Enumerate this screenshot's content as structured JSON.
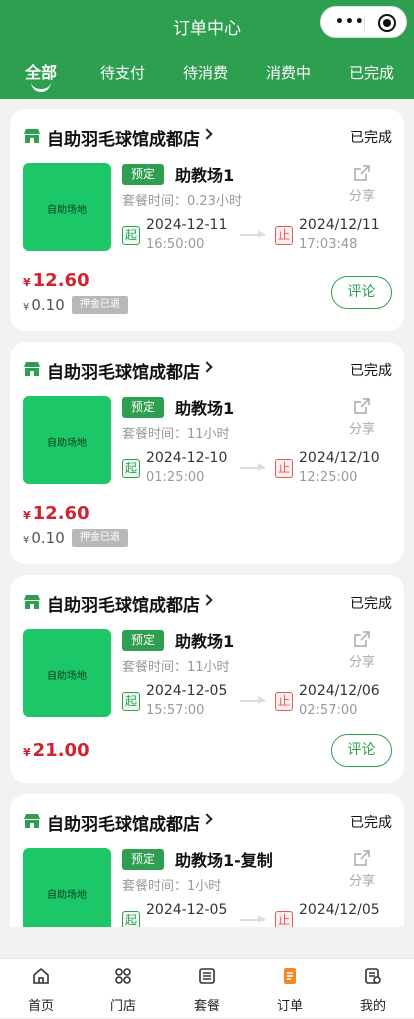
{
  "header": {
    "title": "订单中心"
  },
  "tabs": [
    {
      "label": "全部",
      "active": true
    },
    {
      "label": "待支付"
    },
    {
      "label": "待消费"
    },
    {
      "label": "消费中"
    },
    {
      "label": "已完成"
    }
  ],
  "orders": [
    {
      "shop": "自助羽毛球馆成都店",
      "status": "已完成",
      "thumb_label": "自助场地",
      "badge": "预定",
      "package": "助教场1",
      "duration": "套餐时间：0.23小时",
      "share": "分享",
      "start_tag": "起",
      "start_date": "2024-12-11",
      "start_time": "16:50:00",
      "end_tag": "止",
      "end_date": "2024/12/11",
      "end_time": "17:03:48",
      "currency": "¥",
      "price": "12.60",
      "deposit": "0.10",
      "deposit_tag": "押金已退",
      "review": "评论"
    },
    {
      "shop": "自助羽毛球馆成都店",
      "status": "已完成",
      "thumb_label": "自助场地",
      "badge": "预定",
      "package": "助教场1",
      "duration": "套餐时间：11小时",
      "share": "分享",
      "start_tag": "起",
      "start_date": "2024-12-10",
      "start_time": "01:25:00",
      "end_tag": "止",
      "end_date": "2024/12/10",
      "end_time": "12:25:00",
      "currency": "¥",
      "price": "12.60",
      "deposit": "0.10",
      "deposit_tag": "押金已退"
    },
    {
      "shop": "自助羽毛球馆成都店",
      "status": "已完成",
      "thumb_label": "自助场地",
      "badge": "预定",
      "package": "助教场1",
      "duration": "套餐时间：11小时",
      "share": "分享",
      "start_tag": "起",
      "start_date": "2024-12-05",
      "start_time": "15:57:00",
      "end_tag": "止",
      "end_date": "2024/12/06",
      "end_time": "02:57:00",
      "currency": "¥",
      "price": "21.00",
      "review": "评论"
    },
    {
      "shop": "自助羽毛球馆成都店",
      "status": "已完成",
      "thumb_label": "自助场地",
      "badge": "预定",
      "package": "助教场1-复制",
      "duration": "套餐时间：1小时",
      "share": "分享",
      "start_tag": "起",
      "start_date": "2024-12-05",
      "end_tag": "止",
      "end_date": "2024/12/05"
    }
  ],
  "tabbar": [
    {
      "label": "首页",
      "icon": "home-icon"
    },
    {
      "label": "门店",
      "icon": "store-icon"
    },
    {
      "label": "套餐",
      "icon": "package-icon"
    },
    {
      "label": "订单",
      "icon": "order-icon",
      "active": true,
      "color": "#f08a2c"
    },
    {
      "label": "我的",
      "icon": "profile-icon"
    }
  ],
  "colors": {
    "brand": "#2e9e4f",
    "price": "#d0232f",
    "thumb": "#1cc768"
  }
}
